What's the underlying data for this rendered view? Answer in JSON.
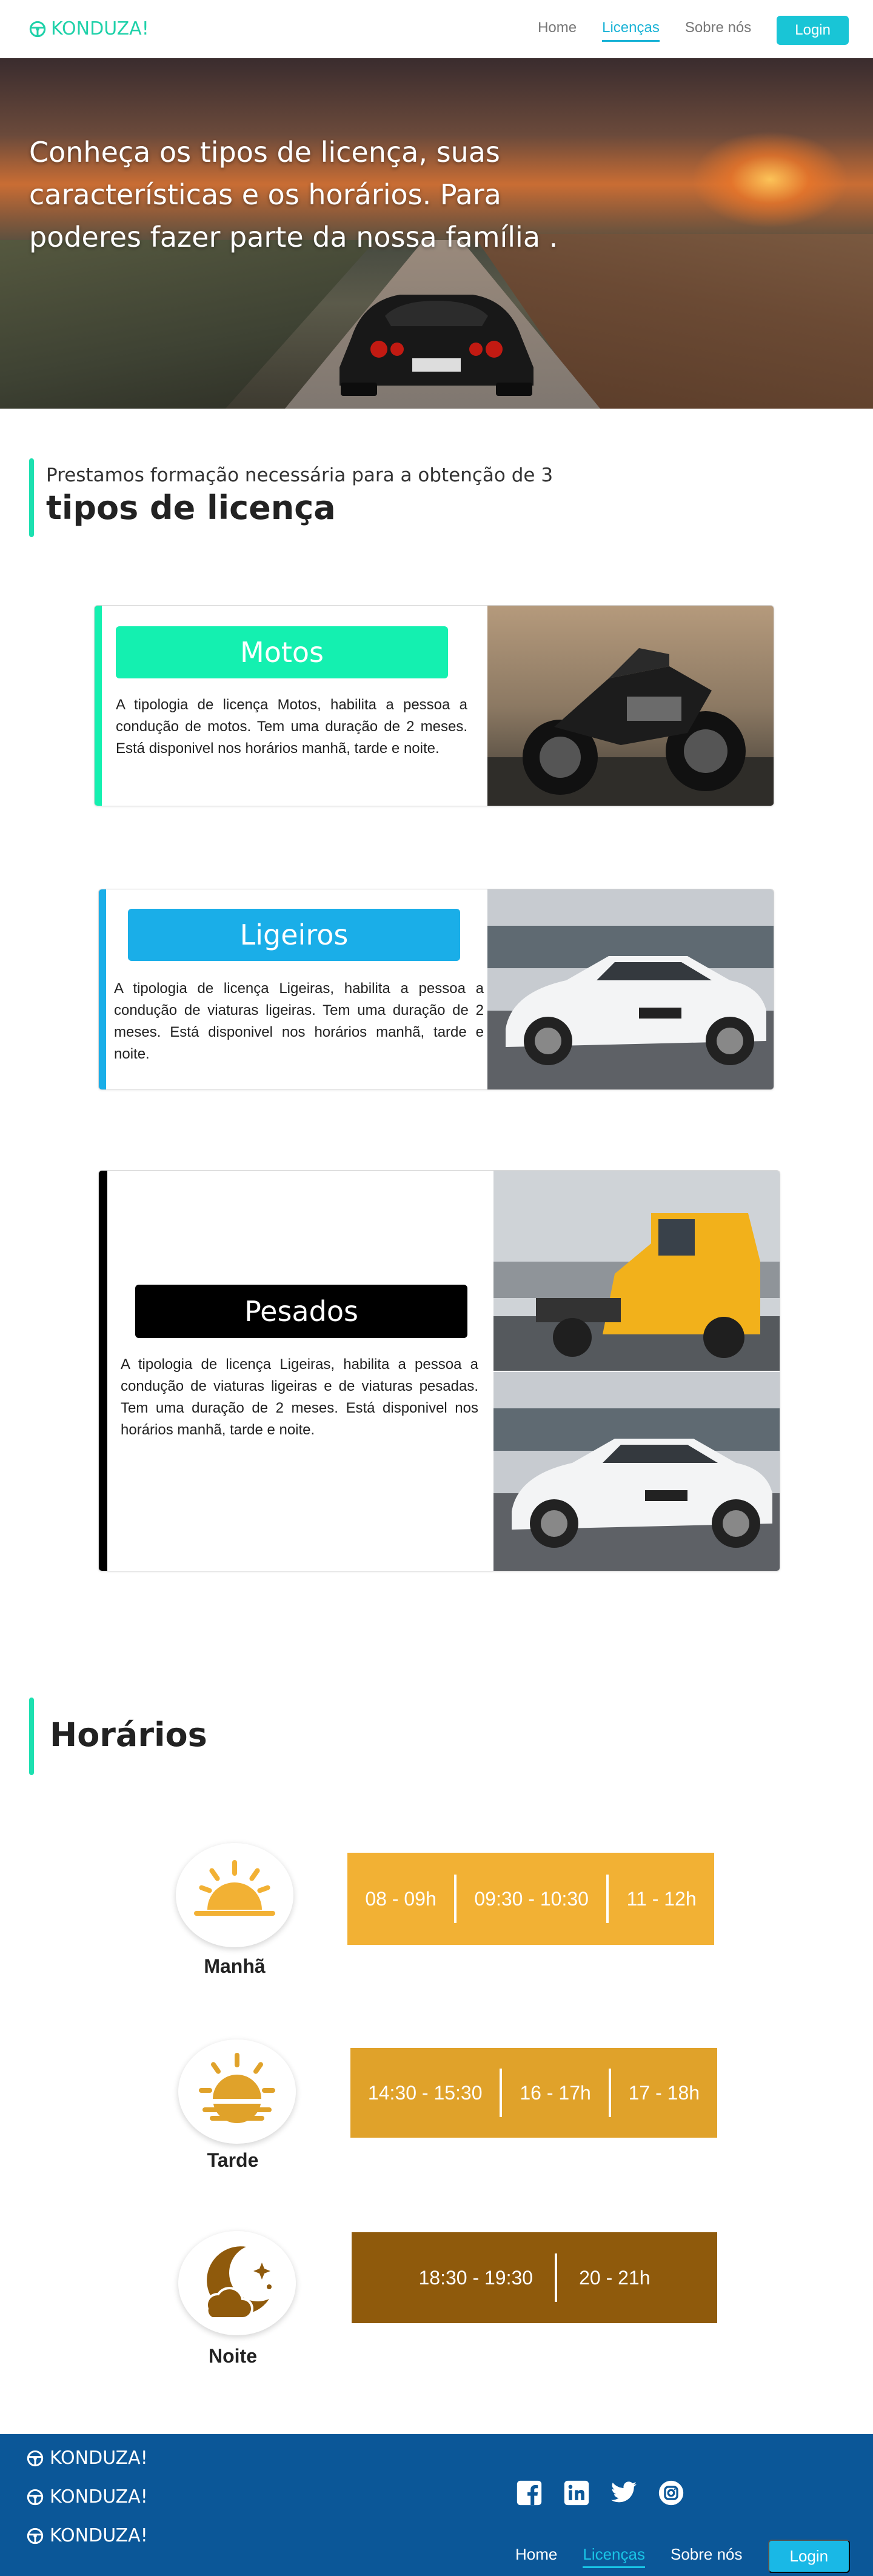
{
  "brand": {
    "name": "KONDUZA!",
    "color": "#1fd1a9"
  },
  "nav": {
    "links": [
      {
        "label": "Home",
        "active": false
      },
      {
        "label": "Licenças",
        "active": true
      },
      {
        "label": "Sobre nós",
        "active": false
      }
    ],
    "login_label": "Login"
  },
  "hero": {
    "text": "Conheça os tipos de licença, suas características e os horários. Para poderes fazer parte da nossa família ."
  },
  "licencas_section": {
    "subtitle": "Prestamos formação necessária para a obtenção de 3",
    "title": "tipos de licença"
  },
  "licencas": [
    {
      "name": "Motos",
      "color": "#14f0b0",
      "description": "A tipologia de licença Motos, habilita a pessoa a condução de motos. Tem uma duração de 2 meses. Está disponivel nos horários manhã, tarde e noite."
    },
    {
      "name": "Ligeiros",
      "color": "#1aaee8",
      "description": "A tipologia de licença Ligeiras, habilita a pessoa a condução de viaturas ligeiras. Tem uma duração de 2 meses. Está disponivel nos horários manhã, tarde e noite."
    },
    {
      "name": "Pesados",
      "color": "#000000",
      "description": "A tipologia de licença Ligeiras, habilita a pessoa a condução de viaturas ligeiras e de viaturas pesadas. Tem uma duração de 2 meses. Está disponivel nos horários manhã, tarde e noite."
    }
  ],
  "horarios_section": {
    "title": "Horários"
  },
  "horarios": [
    {
      "period": "Manhã",
      "icon": "sunrise-icon",
      "color": "#f2b134",
      "slots": [
        "08  -  09h",
        "09:30  -  10:30",
        "11  -  12h"
      ]
    },
    {
      "period": "Tarde",
      "icon": "sunset-icon",
      "color": "#e0a22a",
      "slots": [
        "14:30  -  15:30",
        "16  -  17h",
        "17 - 18h"
      ]
    },
    {
      "period": "Noite",
      "icon": "moon-icon",
      "color": "#8f5a0c",
      "slots": [
        "18:30 - 19:30",
        "20  -  21h"
      ]
    }
  ],
  "footer": {
    "brand_lines": [
      "KONDUZA!",
      "KONDUZA!",
      "KONDUZA!"
    ],
    "social": [
      "facebook-icon",
      "linkedin-icon",
      "twitter-icon",
      "instagram-icon"
    ],
    "links": [
      {
        "label": "Home",
        "active": false
      },
      {
        "label": "Licenças",
        "active": true
      },
      {
        "label": "Sobre nós",
        "active": false
      }
    ],
    "login_label": "Login",
    "background": "#0b5798"
  }
}
